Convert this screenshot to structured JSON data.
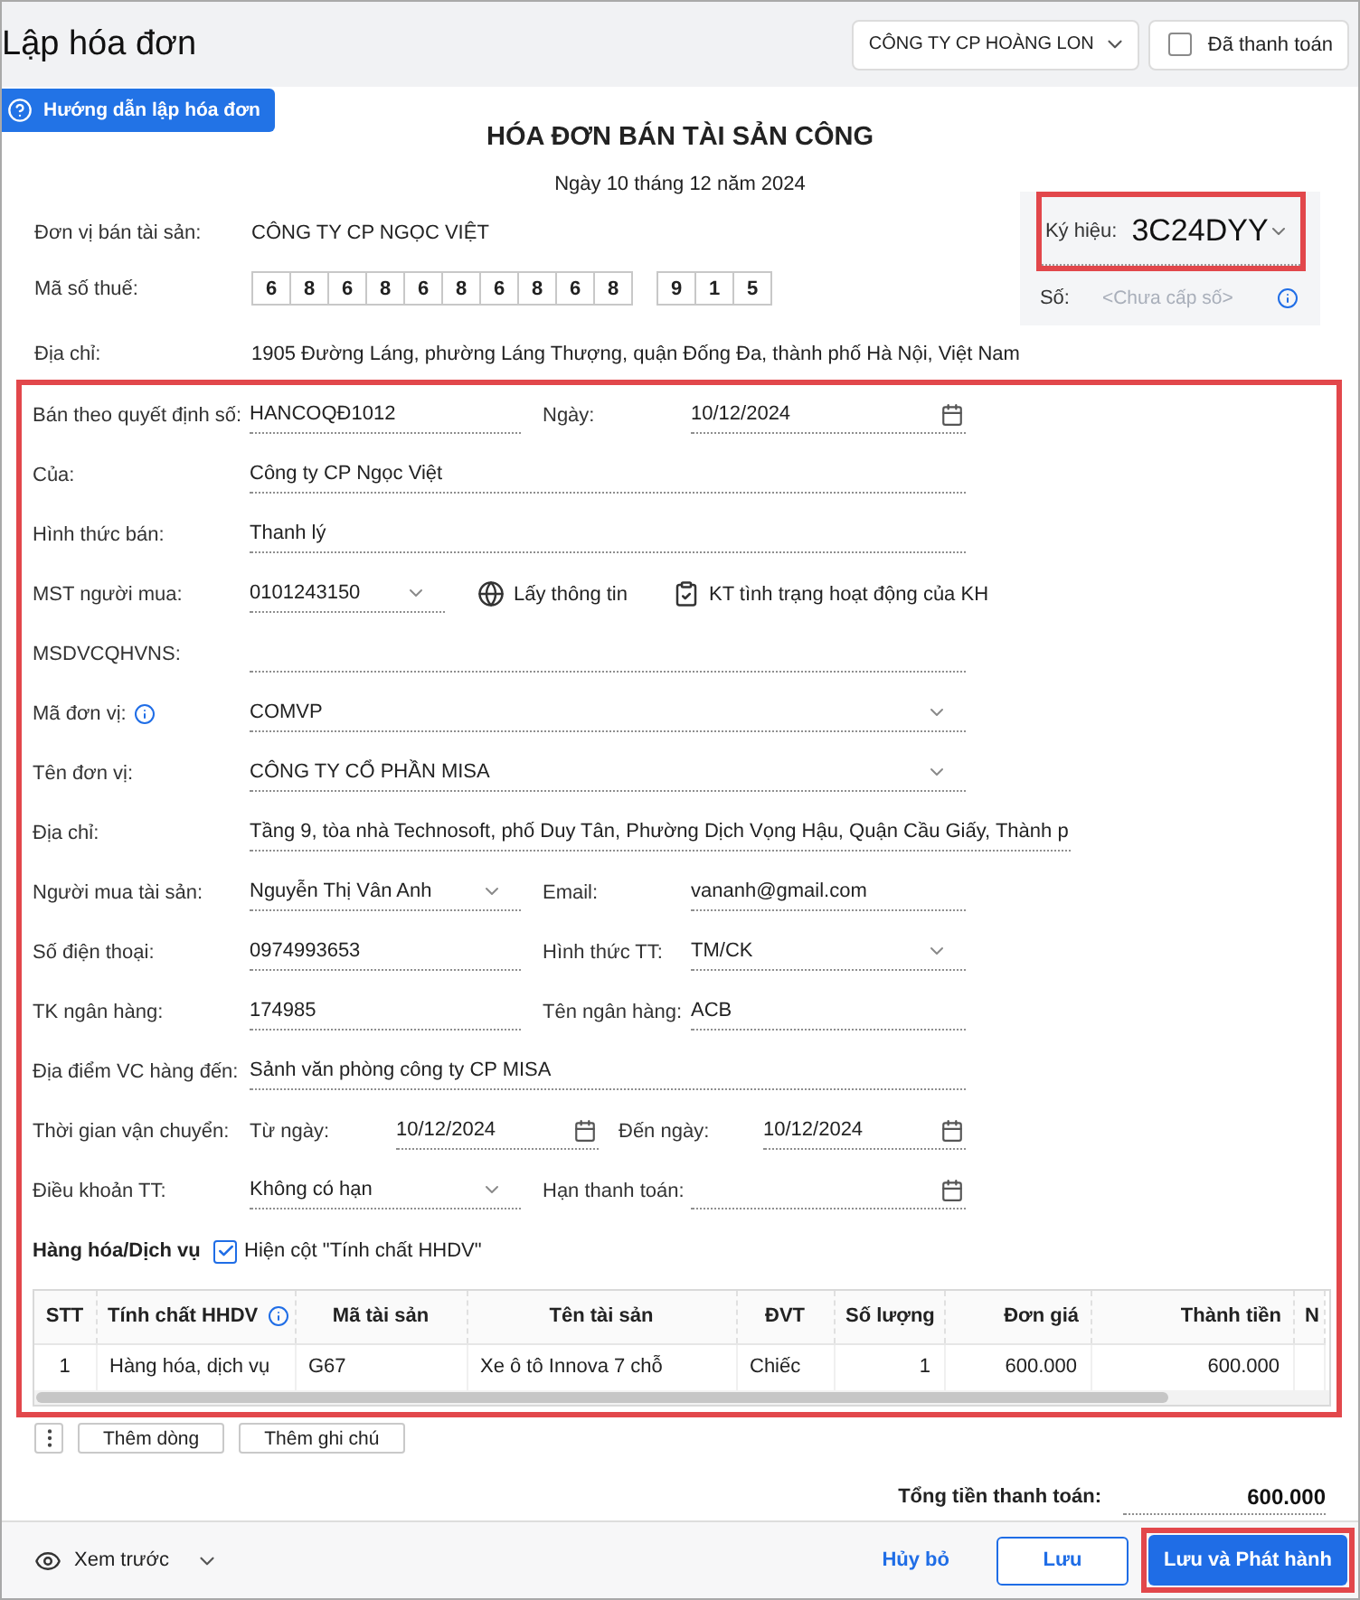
{
  "header": {
    "title": "Lập hóa đơn",
    "company_select": {
      "value": "CÔNG TY CP HOÀNG LON"
    },
    "paid_checkbox": {
      "label": "Đã thanh toán",
      "checked": false
    }
  },
  "guide_button": {
    "label": "Hướng dẫn lập hóa đơn"
  },
  "invoice": {
    "title": "HÓA ĐƠN BÁN TÀI SẢN CÔNG",
    "date": "Ngày 10 tháng 12 năm 2024"
  },
  "seller": {
    "name_label": "Đơn vị bán tài sản:",
    "name": "CÔNG TY CP NGỌC VIỆT",
    "tax_label": "Mã số thuế:",
    "tax_digits": [
      "6",
      "8",
      "6",
      "8",
      "6",
      "8",
      "6",
      "8",
      "6",
      "8"
    ],
    "tax_suffix": [
      "9",
      "1",
      "5"
    ],
    "address_label": "Địa chỉ:",
    "address": "1905 Đường Láng, phường Láng Thượng, quận Đống Đa, thành phố Hà Nội, Việt Nam"
  },
  "symbol_panel": {
    "symbol_label": "Ký hiệu:",
    "symbol": "3C24DYY",
    "highlighted": true,
    "number_label": "Số:",
    "number_placeholder": "<Chưa cấp số>"
  },
  "form": {
    "highlighted": true,
    "rows": [
      {
        "kind": "pair",
        "fields": [
          {
            "label": "Bán theo quyết định số:",
            "value": "HANCOQĐ1012",
            "kind": "text"
          },
          {
            "label": "Ngày:",
            "value": "10/12/2024",
            "kind": "date"
          }
        ]
      },
      {
        "kind": "single",
        "fields": [
          {
            "label": "Của:",
            "value": "Công ty CP Ngọc Việt",
            "kind": "text"
          }
        ]
      },
      {
        "kind": "single",
        "fields": [
          {
            "label": "Hình thức bán:",
            "value": "Thanh lý",
            "kind": "text"
          }
        ]
      },
      {
        "kind": "lookup",
        "fields": [
          {
            "label": "MST người mua:",
            "value": "0101243150",
            "kind": "select"
          }
        ],
        "actions": [
          {
            "label": "Lấy thông tin"
          },
          {
            "label": "KT tình trạng hoạt động của KH"
          }
        ]
      },
      {
        "kind": "single",
        "fields": [
          {
            "label": "MSDVCQHVNS:",
            "kind": "text"
          }
        ]
      },
      {
        "kind": "single",
        "fields": [
          {
            "label": "Mã đơn vị:",
            "info": true,
            "value": "COMVP",
            "kind": "select"
          }
        ]
      },
      {
        "kind": "single",
        "fields": [
          {
            "label": "Tên đơn vị:",
            "value": "CÔNG TY CỔ PHẦN MISA",
            "kind": "select"
          }
        ]
      },
      {
        "kind": "single",
        "fields": [
          {
            "label": "Địa chỉ:",
            "value": "Tầng 9, tòa nhà Technosoft, phố Duy Tân, Phường Dịch Vọng Hậu, Quận Cầu Giấy, Thành p",
            "kind": "text"
          }
        ]
      },
      {
        "kind": "pair",
        "fields": [
          {
            "label": "Người mua tài sản:",
            "value": "Nguyễn Thị Vân Anh",
            "kind": "select"
          },
          {
            "label": "Email:",
            "value": "vananh@gmail.com",
            "kind": "text"
          }
        ]
      },
      {
        "kind": "pair",
        "fields": [
          {
            "label": "Số điện thoại:",
            "value": "0974993653",
            "kind": "text"
          },
          {
            "label": "Hình thức TT:",
            "value": "TM/CK",
            "kind": "select"
          }
        ]
      },
      {
        "kind": "pair",
        "fields": [
          {
            "label": "TK ngân hàng:",
            "value": "174985",
            "kind": "text"
          },
          {
            "label": "Tên ngân hàng:",
            "value": "ACB",
            "kind": "text"
          }
        ]
      },
      {
        "kind": "single",
        "fields": [
          {
            "label": "Địa điểm VC hàng đến:",
            "value": "Sảnh văn phòng công ty CP MISA",
            "kind": "text"
          }
        ]
      },
      {
        "kind": "range",
        "label": "Thời gian vận chuyển:",
        "fields": [
          {
            "label": "Từ ngày:",
            "value": "10/12/2024",
            "kind": "date"
          },
          {
            "label": "Đến ngày:",
            "value": "10/12/2024",
            "kind": "date"
          }
        ]
      },
      {
        "kind": "pair",
        "fields": [
          {
            "label": "Điều khoản TT:",
            "value": "Không có hạn",
            "kind": "select"
          },
          {
            "label": "Hạn thanh toán:",
            "kind": "date"
          }
        ]
      }
    ]
  },
  "goods": {
    "title": "Hàng hóa/Dịch vụ",
    "show_column": {
      "label": "Hiện cột \"Tính chất HHDV\"",
      "checked": true
    },
    "table": {
      "columns": [
        {
          "label": "STT",
          "kind": "index"
        },
        {
          "label": "Tính chất HHDV",
          "kind": "text",
          "info": true
        },
        {
          "label": "Mã tài sản",
          "kind": "text"
        },
        {
          "label": "Tên tài sản",
          "kind": "text"
        },
        {
          "label": "ĐVT",
          "kind": "text"
        },
        {
          "label": "Số lượng",
          "kind": "number"
        },
        {
          "label": "Đơn giá",
          "kind": "number"
        },
        {
          "label": "Thành tiền",
          "kind": "number"
        },
        {
          "label": "N",
          "kind": "text"
        }
      ],
      "rows": [
        [
          "1",
          "Hàng hóa, dịch vụ",
          "G67",
          "Xe ô tô Innova 7 chỗ",
          "Chiếc",
          "1",
          "600.000",
          "600.000"
        ]
      ]
    }
  },
  "table_actions": {
    "buttons": [
      "Thêm dòng",
      "Thêm ghi chú"
    ]
  },
  "total": {
    "label": "Tổng tiền thanh toán:",
    "value": "600.000"
  },
  "footer": {
    "preview": {
      "label": "Xem trước"
    },
    "buttons": [
      {
        "label": "Hủy bỏ",
        "kind": "link",
        "highlighted": false
      },
      {
        "label": "Lưu",
        "kind": "outline",
        "highlighted": false
      },
      {
        "label": "Lưu và Phát hành",
        "kind": "primary",
        "highlighted": true
      }
    ]
  }
}
